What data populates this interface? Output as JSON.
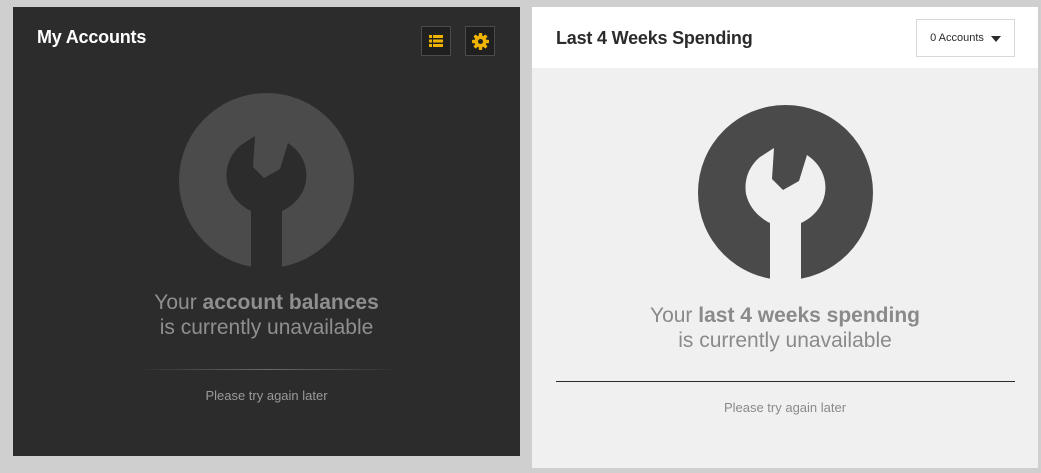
{
  "accounts_panel": {
    "title": "My Accounts",
    "list_button_icon": "list-icon",
    "settings_button_icon": "gear-icon",
    "status_icon": "wrench-icon",
    "message_prefix": "Your ",
    "message_bold": "account balances",
    "message_line2": "is currently unavailable",
    "retry_text": "Please try again later"
  },
  "spending_panel": {
    "title": "Last 4 Weeks Spending",
    "dropdown_label": "0 Accounts",
    "status_icon": "wrench-icon",
    "message_prefix": "Your ",
    "message_bold": "last 4 weeks spending",
    "message_line2": "is currently unavailable",
    "retry_text": "Please try again later"
  },
  "colors": {
    "accent": "#f0b400",
    "dark_panel": "#2c2c2c",
    "light_panel": "#f0f0f0"
  }
}
